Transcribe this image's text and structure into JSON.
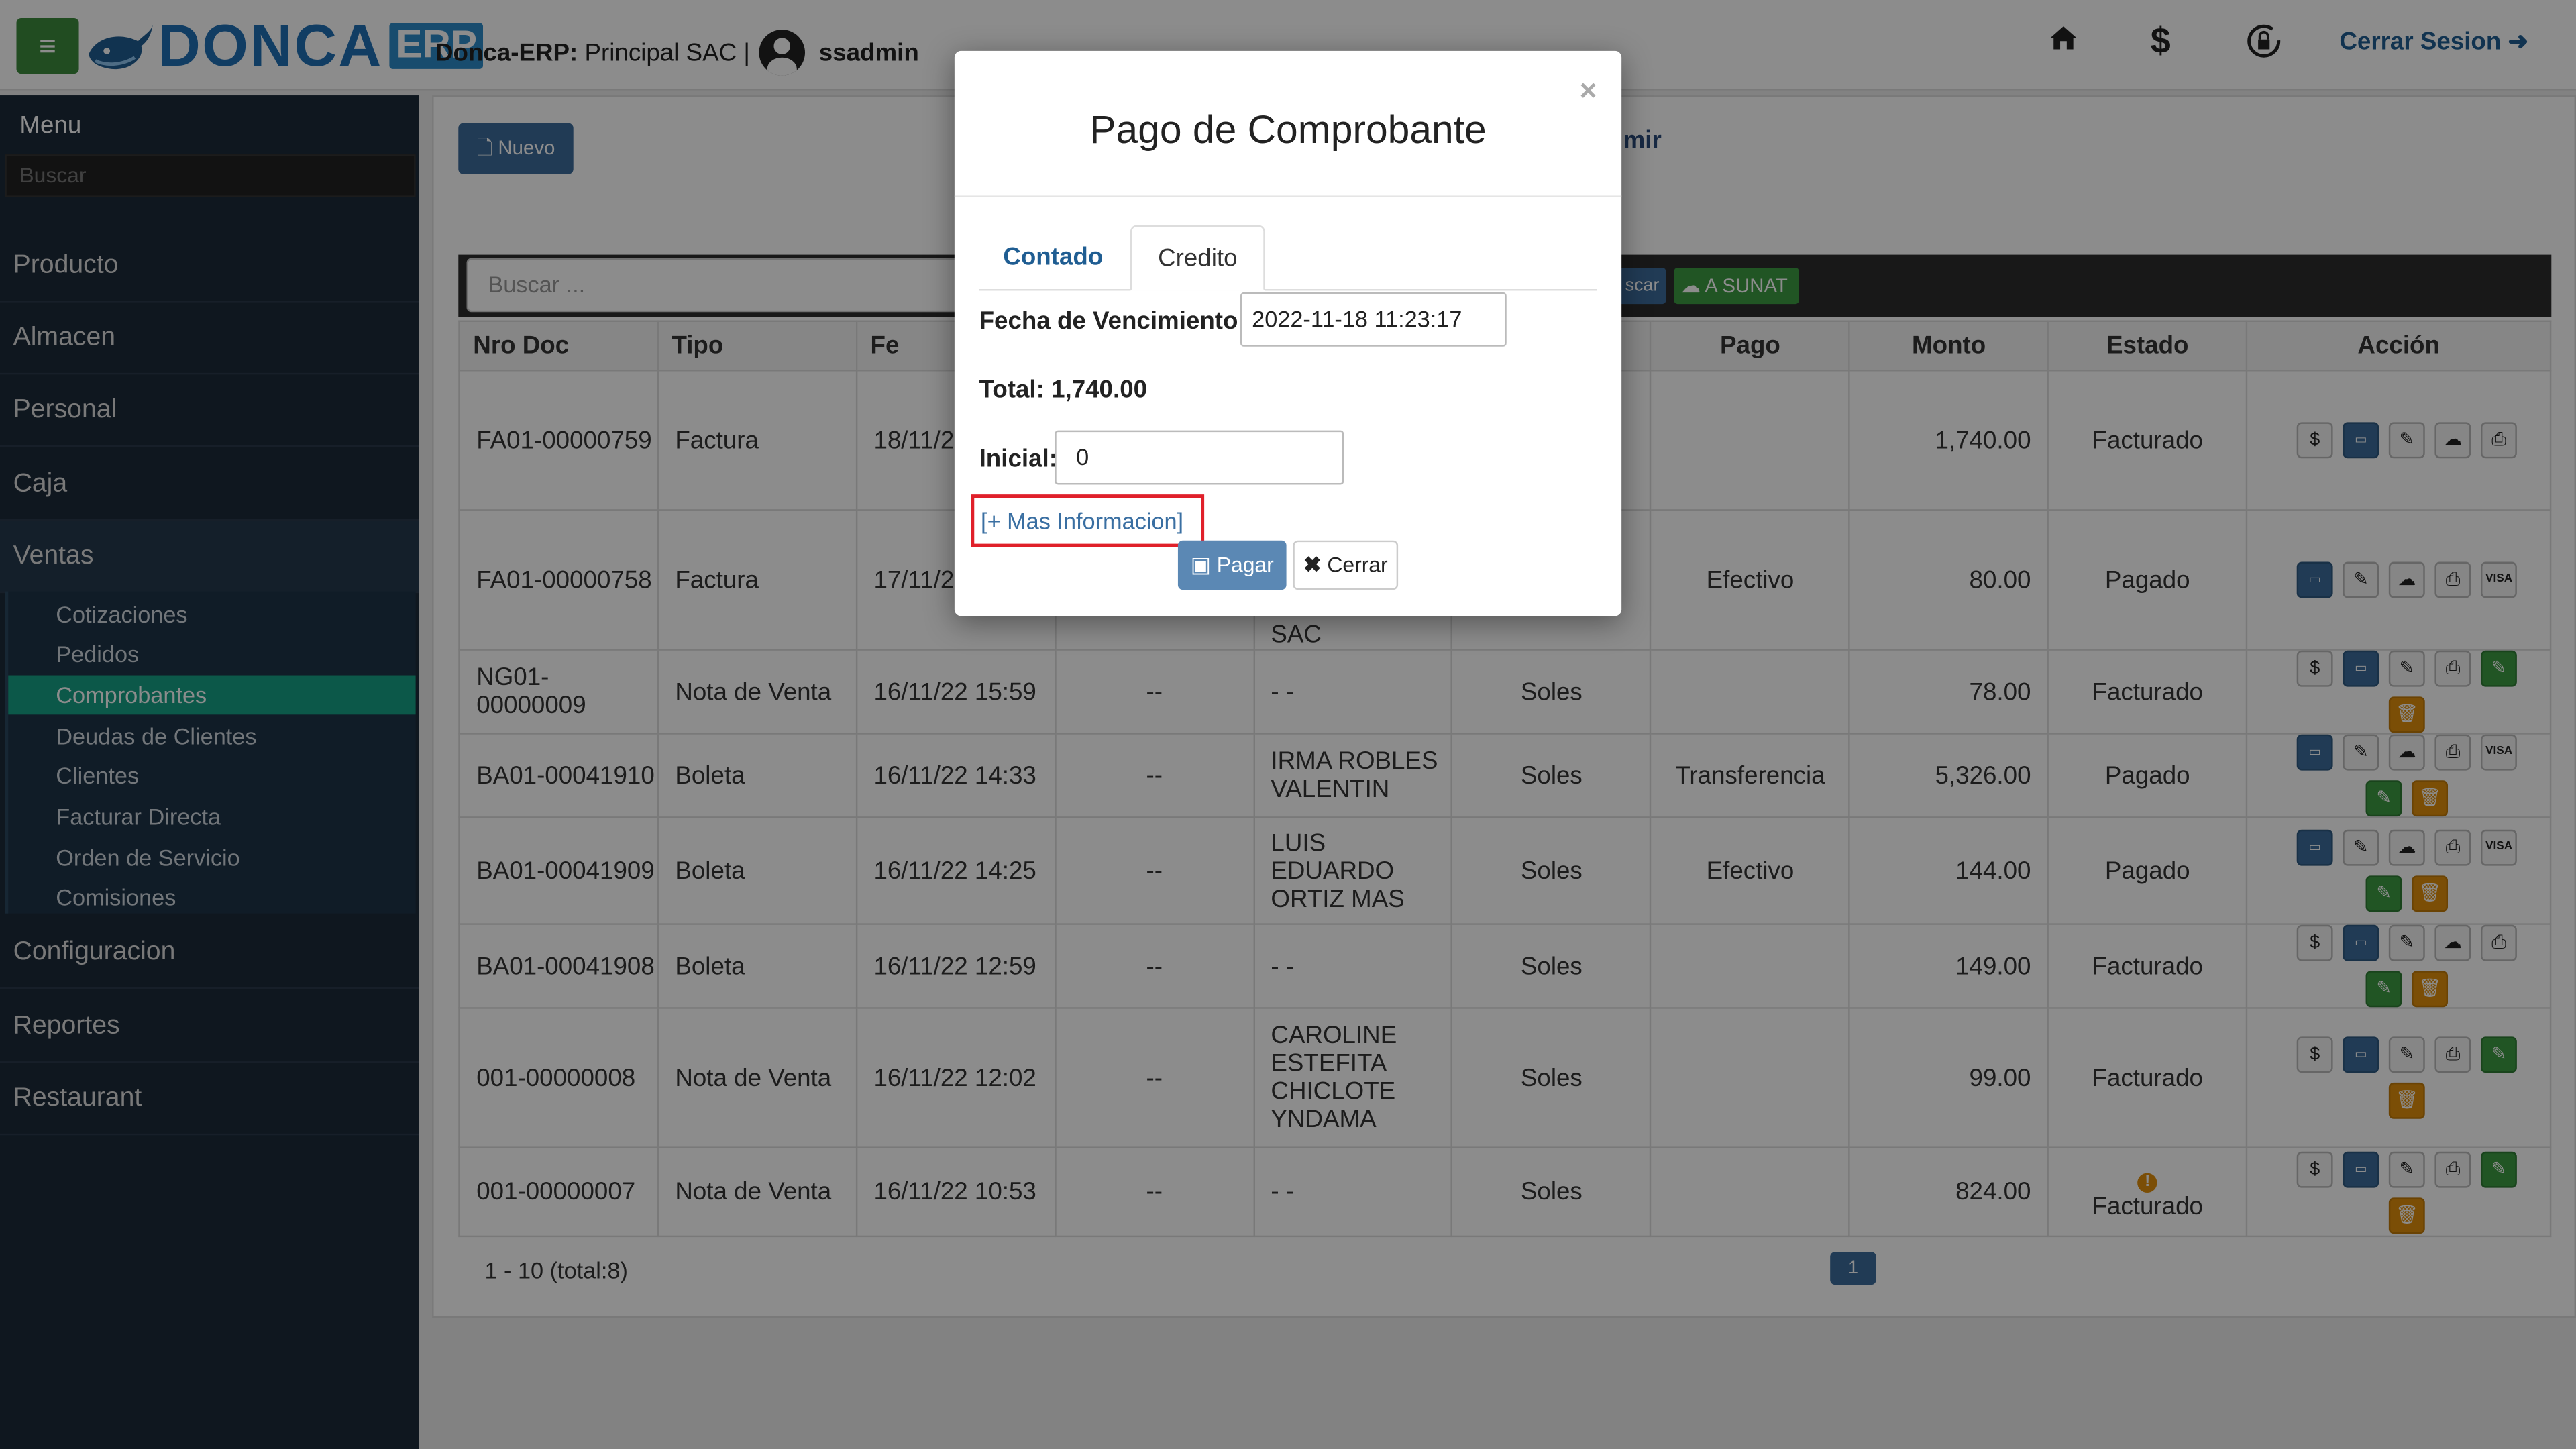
{
  "topbar": {
    "menu_icon": "hamburger-icon",
    "logo_text": "DONCA",
    "logo_suffix": "ERP",
    "company_label": "Donca-ERP:",
    "company_name": "Principal SAC |",
    "username": "ssadmin",
    "icons": [
      "home-icon",
      "dollar-icon",
      "lock-rotate-icon"
    ],
    "logout_label": "Cerrar Sesion"
  },
  "sidebar": {
    "title": "Menu",
    "search_placeholder": "Buscar",
    "items": [
      "Producto",
      "Almacen",
      "Personal",
      "Caja",
      "Ventas"
    ],
    "ventas_sub": [
      "Cotizaciones",
      "Pedidos",
      "Comprobantes",
      "Deudas de Clientes",
      "Clientes",
      "Facturar Directa",
      "Orden de Servicio",
      "Comisiones"
    ],
    "items_after": [
      "Configuracion",
      "Reportes",
      "Restaurant"
    ],
    "active_sub": "Comprobantes"
  },
  "content": {
    "new_button": "Nuevo",
    "print_partial": "mir",
    "search_placeholder": "Buscar ...",
    "search_button_partial": "scar",
    "sunat_button": "A SUNAT",
    "columns": [
      "Nro Doc",
      "Tipo",
      "Fe",
      "",
      "",
      "",
      "Pago",
      "Monto",
      "Estado",
      "Acción"
    ],
    "rows": [
      {
        "nro": "FA01-00000759",
        "tipo": "Factura",
        "fecha": "18/11/2",
        "c4": "",
        "cliente": "",
        "moneda": "",
        "pago": "",
        "monto": "1,740.00",
        "estado": "Facturado"
      },
      {
        "nro": "FA01-00000758",
        "tipo": "Factura",
        "fecha": "17/11/2",
        "c4": "",
        "cliente": "SAC",
        "moneda": "",
        "pago": "Efectivo",
        "monto": "80.00",
        "estado": "Pagado"
      },
      {
        "nro": "NG01-00000009",
        "tipo": "Nota de Venta",
        "fecha": "16/11/22 15:59",
        "c4": "--",
        "cliente": "- -",
        "moneda": "Soles",
        "pago": "",
        "monto": "78.00",
        "estado": "Facturado"
      },
      {
        "nro": "BA01-00041910",
        "tipo": "Boleta",
        "fecha": "16/11/22 14:33",
        "c4": "--",
        "cliente": "IRMA ROBLES VALENTIN",
        "moneda": "Soles",
        "pago": "Transferencia",
        "monto": "5,326.00",
        "estado": "Pagado"
      },
      {
        "nro": "BA01-00041909",
        "tipo": "Boleta",
        "fecha": "16/11/22 14:25",
        "c4": "--",
        "cliente": "LUIS EDUARDO ORTIZ MAS",
        "moneda": "Soles",
        "pago": "Efectivo",
        "monto": "144.00",
        "estado": "Pagado"
      },
      {
        "nro": "BA01-00041908",
        "tipo": "Boleta",
        "fecha": "16/11/22 12:59",
        "c4": "--",
        "cliente": "- -",
        "moneda": "Soles",
        "pago": "",
        "monto": "149.00",
        "estado": "Facturado"
      },
      {
        "nro": "001-00000008",
        "tipo": "Nota de Venta",
        "fecha": "16/11/22 12:02",
        "c4": "--",
        "cliente": "CAROLINE ESTEFITA CHICLOTE YNDAMA",
        "moneda": "Soles",
        "pago": "",
        "monto": "99.00",
        "estado": "Facturado"
      },
      {
        "nro": "001-00000007",
        "tipo": "Nota de Venta",
        "fecha": "16/11/22 10:53",
        "c4": "--",
        "cliente": "- -",
        "moneda": "Soles",
        "pago": "",
        "monto": "824.00",
        "estado": "Facturado"
      }
    ],
    "pager_text": "1 - 10 (total:8)",
    "pager_page": "1"
  },
  "modal": {
    "close": "×",
    "title": "Pago de Comprobante",
    "tab_contado": "Contado",
    "tab_credito": "Credito",
    "fecha_label": "Fecha de Vencimiento:",
    "fecha_value": "2022-11-18 11:23:17",
    "total_label": "Total: 1,740.00",
    "inicial_label": "Inicial:",
    "inicial_value": "0",
    "mas_info": "[+ Mas Informacion]",
    "pagar_label": "Pagar",
    "cerrar_label": "Cerrar"
  }
}
